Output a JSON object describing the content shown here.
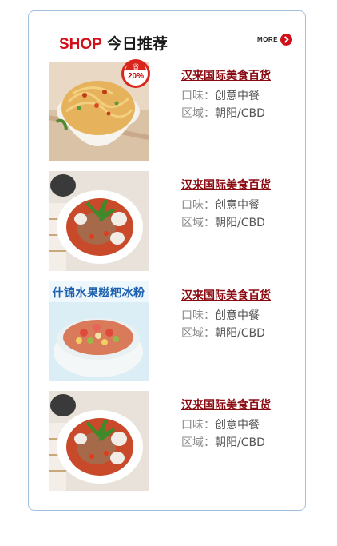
{
  "header": {
    "brand": "SHOP",
    "title": "今日推荐",
    "more_label": "MORE"
  },
  "colors": {
    "brand_red": "#d0101b",
    "link": "#8b0a10",
    "border": "#9fc0dc"
  },
  "items": [
    {
      "name": "汉来国际美食百货",
      "taste_label": "口味：",
      "taste": "创意中餐",
      "area_label": "区域：",
      "area": "朝阳/CBD",
      "image": "noodle-bowl",
      "badge": {
        "top": "省",
        "value": "20%"
      }
    },
    {
      "name": "汉来国际美食百货",
      "taste_label": "口味：",
      "taste": "创意中餐",
      "area_label": "区域：",
      "area": "朝阳/CBD",
      "image": "salad-plate"
    },
    {
      "name": "汉来国际美食百货",
      "taste_label": "口味：",
      "taste": "创意中餐",
      "area_label": "区域：",
      "area": "朝阳/CBD",
      "image": "fruit-ice-bowl",
      "banner": "什锦水果糍粑冰粉"
    },
    {
      "name": "汉来国际美食百货",
      "taste_label": "口味：",
      "taste": "创意中餐",
      "area_label": "区域：",
      "area": "朝阳/CBD",
      "image": "salad-plate"
    }
  ]
}
